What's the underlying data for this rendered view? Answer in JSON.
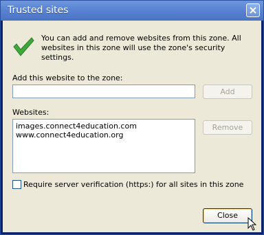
{
  "window": {
    "title": "Trusted sites"
  },
  "intro_text": "You can add and remove websites from this zone. All websites in this zone will use the zone's security settings.",
  "add_label": "Add this website to the zone:",
  "add_input_value": "",
  "add_button": "Add",
  "websites_label": "Websites:",
  "websites": [
    "images.connect4education.com",
    "www.connect4education.org"
  ],
  "remove_button": "Remove",
  "require_https_label": "Require server verification (https:) for all sites in this zone",
  "require_https_checked": false,
  "close_button": "Close",
  "icons": {
    "status": "green-check-icon",
    "window_close": "close-icon"
  }
}
